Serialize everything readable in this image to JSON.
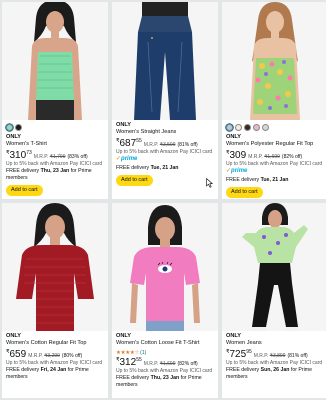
{
  "products": [
    {
      "brand": "ONLY",
      "title": "Women's T-Shirt",
      "swatches": [
        "#9ad8c6",
        "#1c1c1c"
      ],
      "price_symbol": "₹",
      "price_whole": "310",
      "price_fraction": "73",
      "mrp_label": "M.R.P.",
      "mrp": "₹1,799",
      "discount": "(83% off)",
      "offer": "Up to 5% back with Amazon Pay ICICI card",
      "delivery_prefix": "FREE delivery",
      "delivery_date": "Thu, 23 Jan",
      "delivery_suffix": "for Prime members",
      "cart_label": "Add to cart",
      "shirt_color": "#7fdca6"
    },
    {
      "brand": "ONLY",
      "title": "Women's Straight Jeans",
      "price_symbol": "₹",
      "price_whole": "687",
      "price_fraction": "55",
      "mrp_label": "M.R.P.",
      "mrp": "₹3,599",
      "discount": "(81% off)",
      "offer": "Up to 5% back with Amazon Pay ICICI card",
      "prime": "prime",
      "delivery_prefix": "FREE delivery",
      "delivery_date": "Tue, 21 Jan",
      "cart_label": "Add to cart",
      "shirt_color": "#1f3d6b"
    },
    {
      "brand": "ONLY",
      "title": "Women's Polyester Regular Fit Top",
      "swatches": [
        "#c8c0e6",
        "#f2ede0",
        "#3a2a1c",
        "#e7b7c7",
        "#d6d6d6"
      ],
      "price_symbol": "₹",
      "price_whole": "309",
      "price_fraction": "",
      "mrp_label": "M.R.P.",
      "mrp": "₹1,699",
      "discount": "(82% off)",
      "offer": "Up to 5% back with Amazon Pay ICICI card",
      "prime": "prime",
      "delivery_prefix": "FREE delivery",
      "delivery_date": "Tue, 21 Jan",
      "cart_label": "Add to cart",
      "shirt_color": "#9ed37a"
    },
    {
      "brand": "ONLY",
      "title": "Women's Cotton Regular Fit Top",
      "price_symbol": "₹",
      "price_whole": "659",
      "price_fraction": "",
      "mrp_label": "M.R.P.",
      "mrp": "₹3,299",
      "discount": "(80% off)",
      "offer": "Up to 5% back with Amazon Pay ICICI card",
      "delivery_prefix": "FREE delivery",
      "delivery_date": "Fri, 24 Jan",
      "delivery_suffix": "for Prime members",
      "shirt_color": "#a11a24"
    },
    {
      "brand": "ONLY",
      "title": "Women's Cotton Loose Fit T-Shirt",
      "rating": "★★★★☆",
      "rating_count": "(1)",
      "price_symbol": "₹",
      "price_whole": "312",
      "price_fraction": "55",
      "mrp_label": "M.R.P.",
      "mrp": "₹1,699",
      "discount": "(82% off)",
      "offer": "Up to 5% back with Amazon Pay ICICI card",
      "delivery_prefix": "FREE delivery",
      "delivery_date": "Thu, 23 Jan",
      "delivery_suffix": "for Prime members",
      "shirt_color": "#f27cc0"
    },
    {
      "brand": "ONLY",
      "title": "Women Jeans",
      "price_symbol": "₹",
      "price_whole": "725",
      "price_fraction": "95",
      "mrp_label": "M.R.P.",
      "mrp": "₹3,899",
      "discount": "(81% off)",
      "offer": "Up to 5% back with Amazon Pay ICICI card",
      "delivery_prefix": "FREE delivery",
      "delivery_date": "Sun, 26 Jan",
      "delivery_suffix": "for Prime members",
      "shirt_color": "#b9e3a4"
    }
  ]
}
